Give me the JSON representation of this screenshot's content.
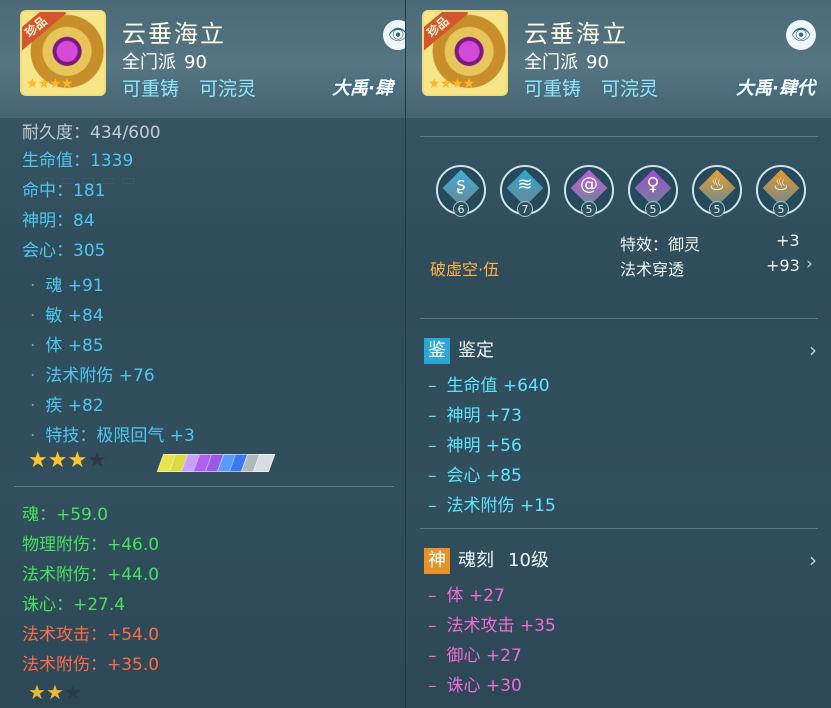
{
  "left": {
    "item": {
      "ribbon": "珍品",
      "name": "云垂海立",
      "sect": "全门派",
      "level": "90",
      "tags": [
        "可重铸",
        "可浣灵"
      ],
      "brand": "大禹·肆",
      "stars_on": 4,
      "stars_total": 4
    },
    "durability_partial": "耐久度：434/600",
    "base_stats": [
      {
        "text": "生命值：1339"
      },
      {
        "text": "命中：181"
      },
      {
        "text": "神明：84"
      },
      {
        "text": "会心：305"
      }
    ],
    "bonus_stats": [
      {
        "text": "魂 +91"
      },
      {
        "text": "敏 +84"
      },
      {
        "text": "体 +85"
      },
      {
        "text": "法术附伤 +76"
      },
      {
        "text": "疾 +82"
      },
      {
        "text": "特技：极限回气 +3"
      }
    ],
    "rating_stars_on": 3,
    "rating_stars_total": 4,
    "gems": [
      "#e6e64a",
      "#d8dc40",
      "#c8a0ff",
      "#b060f0",
      "#9a5ae6",
      "#5a9aff",
      "#3a78f0",
      "#b0b8c0",
      "#d8dde2"
    ],
    "green_stats": [
      {
        "text": "魂：+59.0"
      },
      {
        "text": "物理附伤：+46.0"
      },
      {
        "text": "法术附伤：+44.0"
      },
      {
        "text": "诛心：+27.4"
      }
    ],
    "red_stats": [
      {
        "text": "法术攻击：+54.0"
      },
      {
        "text": "法术附伤：+35.0"
      }
    ]
  },
  "right": {
    "item": {
      "ribbon": "珍品",
      "name": "云垂海立",
      "sect": "全门派",
      "level": "90",
      "tags": [
        "可重铸",
        "可浣灵"
      ],
      "brand": "大禹·肆代",
      "stars_on": 4,
      "stars_total": 4
    },
    "runes": [
      {
        "level": "6",
        "color": "#3ab0d8",
        "glyph": "ʂ"
      },
      {
        "level": "7",
        "color": "#2aa6d0",
        "glyph": "≋"
      },
      {
        "level": "5",
        "color": "#c15ae0",
        "glyph": "@"
      },
      {
        "level": "5",
        "color": "#a64ad8",
        "glyph": "♀"
      },
      {
        "level": "5",
        "color": "#e8a030",
        "glyph": "♨"
      },
      {
        "level": "5",
        "color": "#e89a28",
        "glyph": "♨"
      }
    ],
    "rune_combo": "破虚空·伍",
    "effects": [
      {
        "label": "特效：御灵",
        "value": "+3"
      },
      {
        "label": "法术穿透",
        "value": "+93"
      }
    ],
    "appraise": {
      "badge": "鉴",
      "title": "鉴定",
      "badge_color": "#2aa7d6",
      "lines": [
        {
          "text": "生命值  +640"
        },
        {
          "text": "神明  +73"
        },
        {
          "text": "神明  +56"
        },
        {
          "text": "会心  +85"
        },
        {
          "text": "法术附伤  +15"
        }
      ]
    },
    "soul": {
      "badge": "神",
      "title": "魂刻",
      "level": "10级",
      "badge_color": "#e8922c",
      "lines": [
        {
          "text": "体  +27"
        },
        {
          "text": "法术攻击  +35"
        },
        {
          "text": "御心  +27"
        },
        {
          "text": "诛心  +30"
        }
      ]
    }
  },
  "colors": {
    "blue": "#4fc6f0",
    "green": "#43e25c",
    "red": "#ff6a4a",
    "cyan": "#5fe4ff",
    "pink": "#f06cd8",
    "orange": "#ffb24a"
  }
}
